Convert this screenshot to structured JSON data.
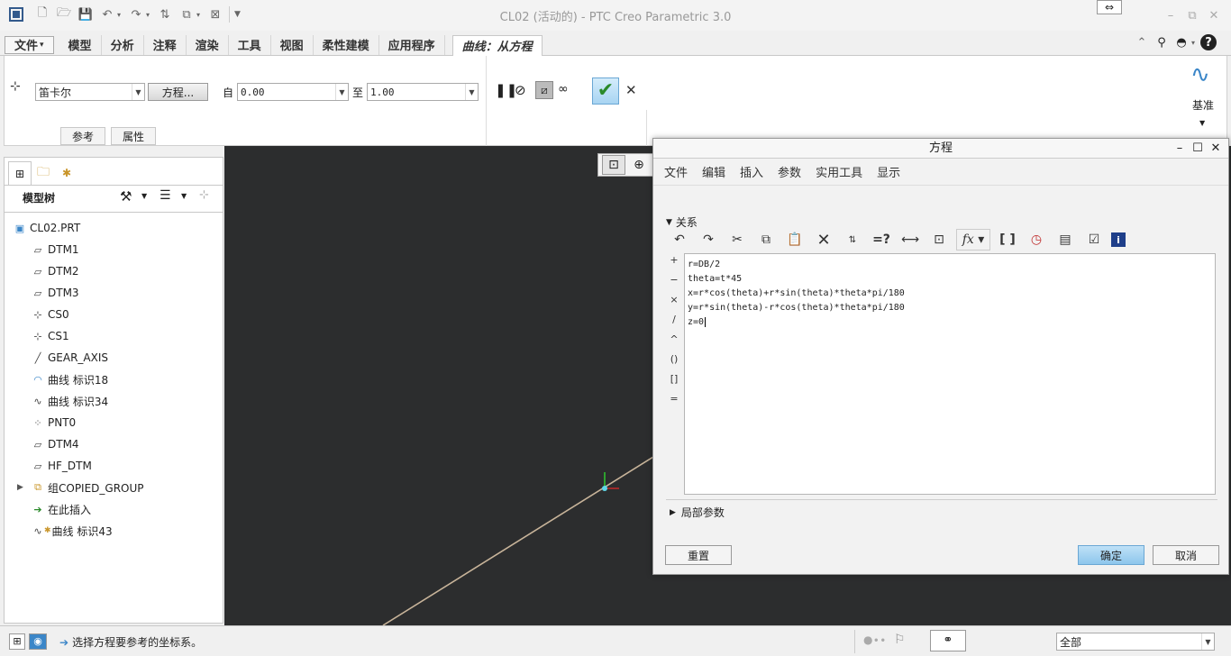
{
  "window": {
    "title": "CL02 (活动的) - PTC Creo Parametric 3.0"
  },
  "menu": {
    "tabs": [
      {
        "label": "文件",
        "arrow": "▾"
      },
      {
        "label": "模型"
      },
      {
        "label": "分析"
      },
      {
        "label": "注释"
      },
      {
        "label": "渲染"
      },
      {
        "label": "工具"
      },
      {
        "label": "视图"
      },
      {
        "label": "柔性建模"
      },
      {
        "label": "应用程序"
      },
      {
        "label": "曲线：从方程"
      }
    ]
  },
  "ribbon": {
    "coord_system": "笛卡尔",
    "equation_button": "方程...",
    "from_label": "自",
    "from_value": "0.00",
    "to_label": "至",
    "to_value": "1.00",
    "subtabs": [
      "参考",
      "属性"
    ],
    "datum_label": "基准"
  },
  "sidebar": {
    "title": "模型树",
    "items": [
      {
        "label": "CL02.PRT",
        "icon": "part-icon"
      },
      {
        "label": "DTM1",
        "icon": "plane-icon"
      },
      {
        "label": "DTM2",
        "icon": "plane-icon"
      },
      {
        "label": "DTM3",
        "icon": "plane-icon"
      },
      {
        "label": "CS0",
        "icon": "csys-icon"
      },
      {
        "label": "CS1",
        "icon": "csys-icon"
      },
      {
        "label": "GEAR_AXIS",
        "icon": "axis-icon"
      },
      {
        "label": "曲线 标识18",
        "icon": "curve-icon"
      },
      {
        "label": "曲线 标识34",
        "icon": "curve-icon"
      },
      {
        "label": "PNT0",
        "icon": "point-icon"
      },
      {
        "label": "DTM4",
        "icon": "plane-icon"
      },
      {
        "label": "HF_DTM",
        "icon": "plane-icon"
      },
      {
        "label": "组COPIED_GROUP",
        "icon": "group-icon"
      },
      {
        "label": "在此插入",
        "icon": "insert-arrow-icon"
      },
      {
        "label": "曲线 标识43",
        "icon": "curve-icon"
      }
    ]
  },
  "dialog": {
    "title": "方程",
    "menu": [
      "文件",
      "编辑",
      "插入",
      "参数",
      "实用工具",
      "显示"
    ],
    "relations_label": "关系",
    "operators": [
      "+",
      "−",
      "×",
      "/",
      "^",
      "()",
      "[]",
      "="
    ],
    "lines": [
      "r=DB/2",
      "theta=t*45",
      "x=r*cos(theta)+r*sin(theta)*theta*pi/180",
      "y=r*sin(theta)-r*cos(theta)*theta*pi/180",
      "z=0"
    ],
    "local_params_label": "局部参数",
    "reset_button": "重置",
    "ok_button": "确定",
    "cancel_button": "取消"
  },
  "status": {
    "message": "选择方程要参考的坐标系。",
    "filter": "全部"
  },
  "colors": {
    "viewport_bg": "#2c2d2e",
    "accent": "#3b86c8"
  }
}
